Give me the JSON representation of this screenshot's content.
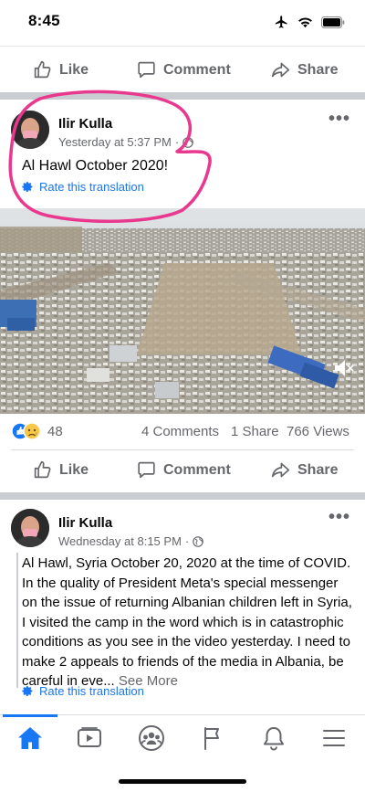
{
  "status": {
    "time": "8:45"
  },
  "actions": {
    "like": "Like",
    "comment": "Comment",
    "share": "Share"
  },
  "post1": {
    "author": "Ilir Kulla",
    "time": "Yesterday at 5:37 PM",
    "text": "Al Hawl October 2020!",
    "translation": "Rate this translation",
    "reactions_count": "48",
    "comments": "4 Comments",
    "shares": "1 Share",
    "views": "766 Views"
  },
  "post2": {
    "author": "Ilir Kulla",
    "time": "Wednesday at 8:15 PM",
    "text": "Al Hawl, Syria October 20, 2020 at the time of COVID. In the quality of President Meta's special messenger on the issue of returning Albanian children left in Syria, I visited the camp in the word which is in catastrophic conditions as you see in the video yesterday. I need to make 2 appeals to friends of the media in Albania, be careful in eve...",
    "see_more": "See More",
    "translation": "Rate this translation"
  },
  "icons": {
    "status": [
      "airplane-icon",
      "wifi-icon",
      "battery-icon"
    ],
    "actions": [
      "like-icon",
      "comment-icon",
      "share-icon"
    ],
    "tabs": [
      "home-icon",
      "watch-icon",
      "groups-icon",
      "pages-flag-icon",
      "notifications-bell-icon",
      "menu-icon"
    ]
  },
  "colors": {
    "brand": "#1877f2",
    "annotation": "#e8398f",
    "muted": "#65676b"
  }
}
